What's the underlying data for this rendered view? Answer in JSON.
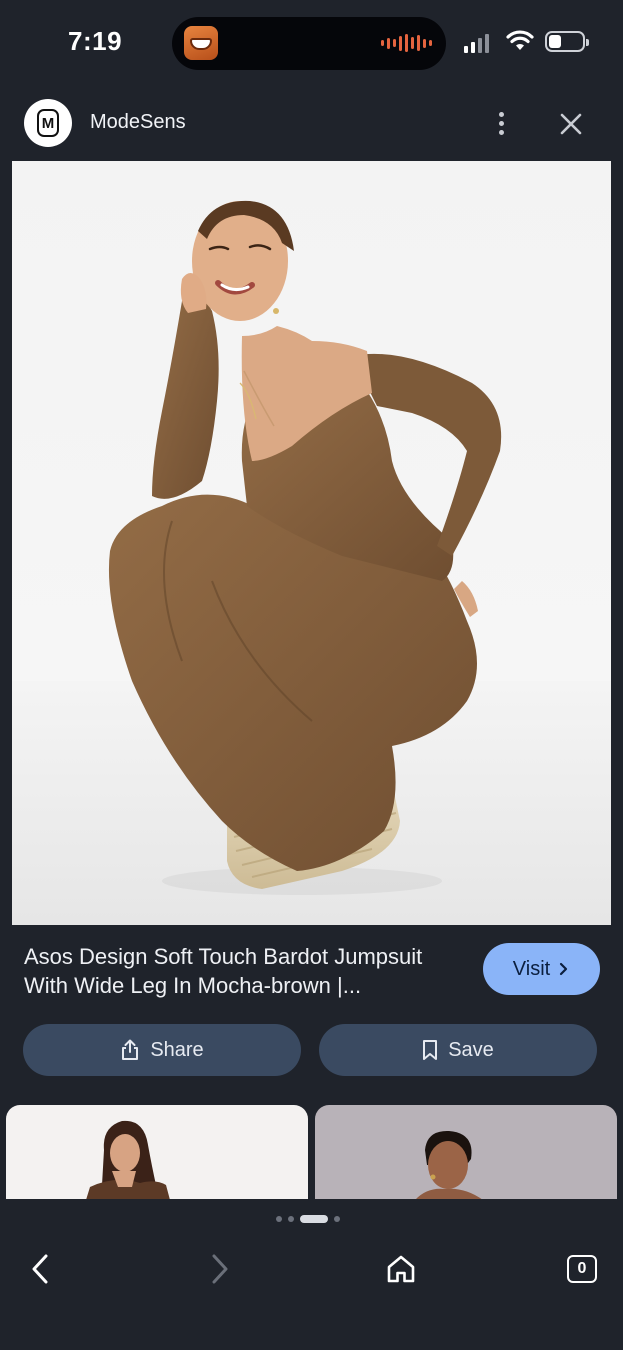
{
  "status": {
    "time": "7:19"
  },
  "header": {
    "site_name": "ModeSens",
    "logo_letter": "M"
  },
  "result": {
    "title": "Asos Design Soft Touch Bardot Jumpsuit With Wide Leg In Mocha-brown |...",
    "visit_label": "Visit",
    "share_label": "Share",
    "save_label": "Save"
  },
  "bottom_nav": {
    "tab_count": "0"
  },
  "colors": {
    "background": "#1f232b",
    "visit_button": "#8ab4f8",
    "action_button": "#3a4a61",
    "jumpsuit": "#8a6440"
  }
}
